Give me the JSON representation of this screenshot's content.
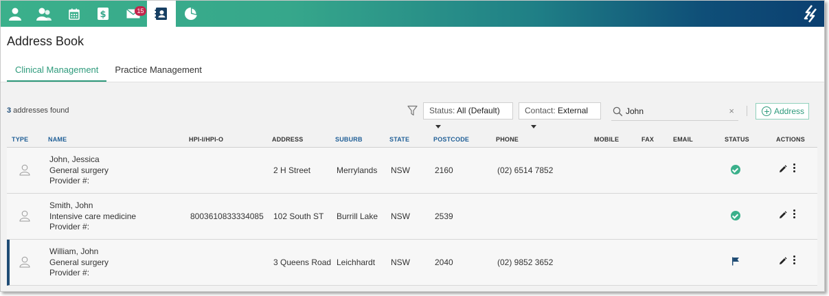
{
  "nav": {
    "items": [
      {
        "icon": "patient-icon"
      },
      {
        "icon": "patients-icon"
      },
      {
        "icon": "calendar-icon"
      },
      {
        "icon": "billing-icon"
      },
      {
        "icon": "mail-icon",
        "badge": "15"
      },
      {
        "icon": "address-book-icon",
        "active": true
      },
      {
        "icon": "reports-icon"
      }
    ],
    "brand_icon": "brand-logo-icon",
    "colors": {
      "gradient_start": "#3bb08b",
      "gradient_end": "#0b3f70",
      "badge": "#c2254b"
    }
  },
  "page": {
    "title": "Address Book",
    "tabs": [
      {
        "label": "Clinical Management",
        "active": true
      },
      {
        "label": "Practice Management",
        "active": false
      }
    ]
  },
  "toolbar": {
    "count": "3",
    "count_suffix": " addresses found",
    "status_label": "Status: ",
    "status_value": "All (Default)",
    "contact_label": "Contact: ",
    "contact_value": "External",
    "search_value": "John",
    "clear_glyph": "×",
    "add_label": "Address"
  },
  "table": {
    "columns": [
      "TYPE",
      "NAME",
      "HPI-I/HPI-O",
      "ADDRESS",
      "SUBURB",
      "STATE",
      "POSTCODE",
      "PHONE",
      "MOBILE",
      "FAX",
      "EMAIL",
      "STATUS",
      "ACTIONS"
    ],
    "sorted_columns": [
      "TYPE",
      "NAME",
      "SUBURB",
      "STATE",
      "POSTCODE"
    ],
    "rows": [
      {
        "name": "John, Jessica",
        "specialty": "General surgery",
        "provider": "Provider #:",
        "hpi": "",
        "address": "2 H Street",
        "suburb": "Merrylands",
        "state": "NSW",
        "postcode": "2160",
        "phone": "(02) 6514 7852",
        "mobile": "",
        "fax": "",
        "email": "",
        "status": "active"
      },
      {
        "name": "Smith, John",
        "specialty": "Intensive care medicine",
        "provider": "Provider #:",
        "hpi": "8003610833334085",
        "address": "102 South ST",
        "suburb": "Burrill Lake",
        "state": "NSW",
        "postcode": "2539",
        "phone": "",
        "mobile": "",
        "fax": "",
        "email": "",
        "status": "active"
      },
      {
        "name": "William, John",
        "specialty": "General surgery",
        "provider": "Provider #:",
        "hpi": "",
        "address": "3 Queens Road",
        "suburb": "Leichhardt",
        "state": "NSW",
        "postcode": "2040",
        "phone": "(02) 9852 3652",
        "mobile": "",
        "fax": "",
        "email": "",
        "status": "flagged",
        "selected": true
      }
    ],
    "colors": {
      "status_active": "#3bb08b",
      "status_flag": "#1e4b74",
      "sorted_header": "#1f5e96"
    }
  }
}
